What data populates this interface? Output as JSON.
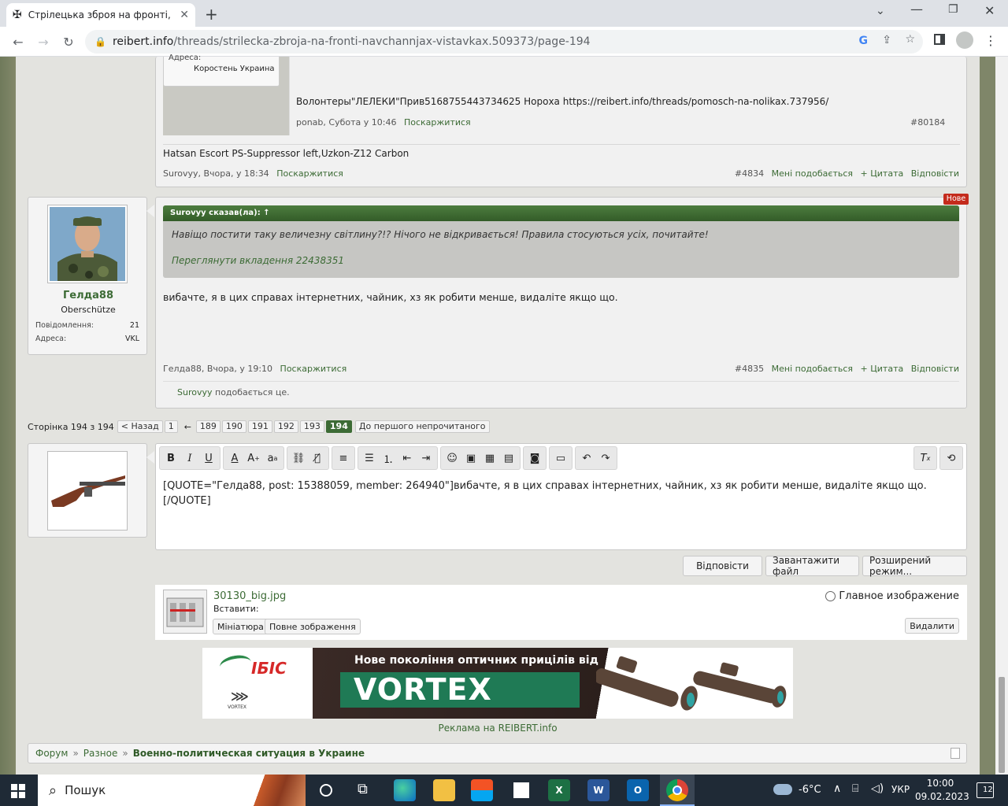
{
  "browser": {
    "tab_title": "Стрілецька зброя на фронті, нав",
    "url_host": "reibert.info",
    "url_path": "/threads/strilecka-zbroja-na-fronti-navchannjax-vistavkax.509373/page-194"
  },
  "post_top": {
    "location_label": "Адреса:",
    "location_value": "Коростень Украина",
    "quote_text": "Волонтеры\"ЛЕЛЕКИ\"Прив5168755443734625 Нороха https://reibert.info/threads/pomosch-na-nolikax.737956/",
    "quote_meta_author": "ponab, Субота у 10:46",
    "quote_meta_report": "Поскаржитися",
    "quote_meta_num": "#80184",
    "body": "Hatsan Escort PS-Suppressor left,Uzkon-Z12 Carbon",
    "author_date": "Surovyy, Вчора, у 18:34",
    "report": "Поскаржитися",
    "num": "#4834",
    "like": "Мені подобається",
    "quote": "+ Цитата",
    "reply": "Відповісти"
  },
  "post_main": {
    "username": "Гелда88",
    "rank": "Oberschütze",
    "stat1_label": "Повідомлення:",
    "stat1_value": "21",
    "stat2_label": "Адреса:",
    "stat2_value": "VKL",
    "new_badge": "Нове",
    "quote_header": "Surovyy сказав(ла): ↑",
    "quote_text": "Навіщо постити таку величезну світлину?!? Нічого не відкривається! Правила стосуються усіх, почитайте!",
    "quote_attachment": "Переглянути вкладення 22438351",
    "body": "вибачте, я в цих справах інтернетних, чайник, хз як робити менше, видаліте якщо що.",
    "author_date": "Гелда88, Вчора, у 19:10",
    "report": "Поскаржитися",
    "num": "#4835",
    "like": "Мені подобається",
    "quote": "+ Цитата",
    "reply": "Відповісти",
    "liked_user": "Surovyy",
    "liked_suffix": " подобається це."
  },
  "pagination": {
    "label": "Сторінка 194 з 194",
    "prev": "< Назад",
    "first": "1",
    "dots": "←",
    "pages": [
      "189",
      "190",
      "191",
      "192",
      "193"
    ],
    "current": "194",
    "unread": "До першого непрочитаного"
  },
  "editor": {
    "text_line1": "[QUOTE=\"Гелда88, post: 15388059, member: 264940\"]вибачте, я в цих справах інтернетних, чайник, хз як робити менше, видаліте  якщо що.",
    "text_line2": "[/QUOTE]",
    "submit": "Відповісти",
    "upload": "Завантажити файл",
    "advanced": "Розширений режим..."
  },
  "attachment": {
    "filename": "30130_big.jpg",
    "insert_label": "Вставити:",
    "thumb_btn": "Мініатюра",
    "full_btn": "Повне зображення",
    "main_image": "Главное изображение",
    "delete": "Видалити"
  },
  "ad": {
    "brand": "ІБІС",
    "headline": "Нове покоління оптичних прицілів від",
    "product": "VORTEX",
    "small": "VORTEX",
    "caption": "Реклама на REIBERT.info"
  },
  "breadcrumb": {
    "items": [
      "Форум",
      "Разное"
    ],
    "current": "Военно-политическая ситуация в Украине",
    "sep": "»"
  },
  "taskbar": {
    "search": "Пошук",
    "weather": "-6°C",
    "lang": "УКР",
    "time": "10:00",
    "date": "09.02.2023",
    "notif": "12"
  }
}
